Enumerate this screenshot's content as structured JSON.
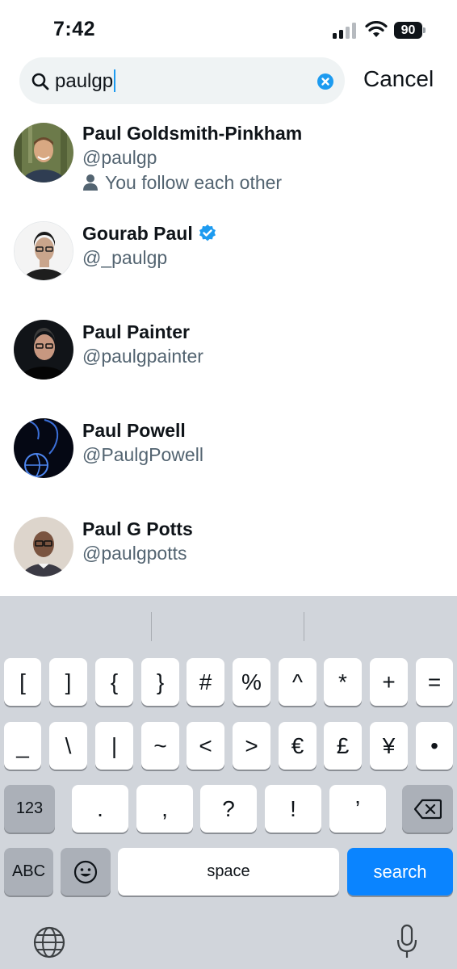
{
  "status_bar": {
    "time": "7:42",
    "battery": "90"
  },
  "search": {
    "query": "paulgp",
    "cancel_label": "Cancel"
  },
  "results": [
    {
      "name": "Paul Goldsmith-Pinkham",
      "handle": "@paulgp",
      "verified": false,
      "follow_note": "You follow each other"
    },
    {
      "name": "Gourab Paul",
      "handle": "@_paulgp",
      "verified": true,
      "follow_note": ""
    },
    {
      "name": "Paul Painter",
      "handle": "@paulgpainter",
      "verified": false,
      "follow_note": ""
    },
    {
      "name": "Paul Powell",
      "handle": "@PaulgPowell",
      "verified": false,
      "follow_note": ""
    },
    {
      "name": "Paul G Potts",
      "handle": "@paulgpotts",
      "verified": false,
      "follow_note": ""
    }
  ],
  "keyboard": {
    "row1": [
      "[",
      "]",
      "{",
      "}",
      "#",
      "%",
      "^",
      "*",
      "+",
      "="
    ],
    "row2": [
      "_",
      "\\",
      "|",
      "~",
      "<",
      ">",
      "€",
      "£",
      "¥",
      "•"
    ],
    "row3_mode": "123",
    "row3": [
      ".",
      ",",
      "?",
      "!",
      "’"
    ],
    "abc": "ABC",
    "space": "space",
    "search": "search"
  },
  "colors": {
    "accent": "#1d9bf0",
    "search_key": "#0a84ff",
    "keyboard_bg": "#d1d5db"
  },
  "icons": [
    "search-icon",
    "clear-icon",
    "verified-badge-icon",
    "person-icon",
    "backspace-icon",
    "emoji-icon",
    "globe-icon",
    "microphone-icon"
  ]
}
